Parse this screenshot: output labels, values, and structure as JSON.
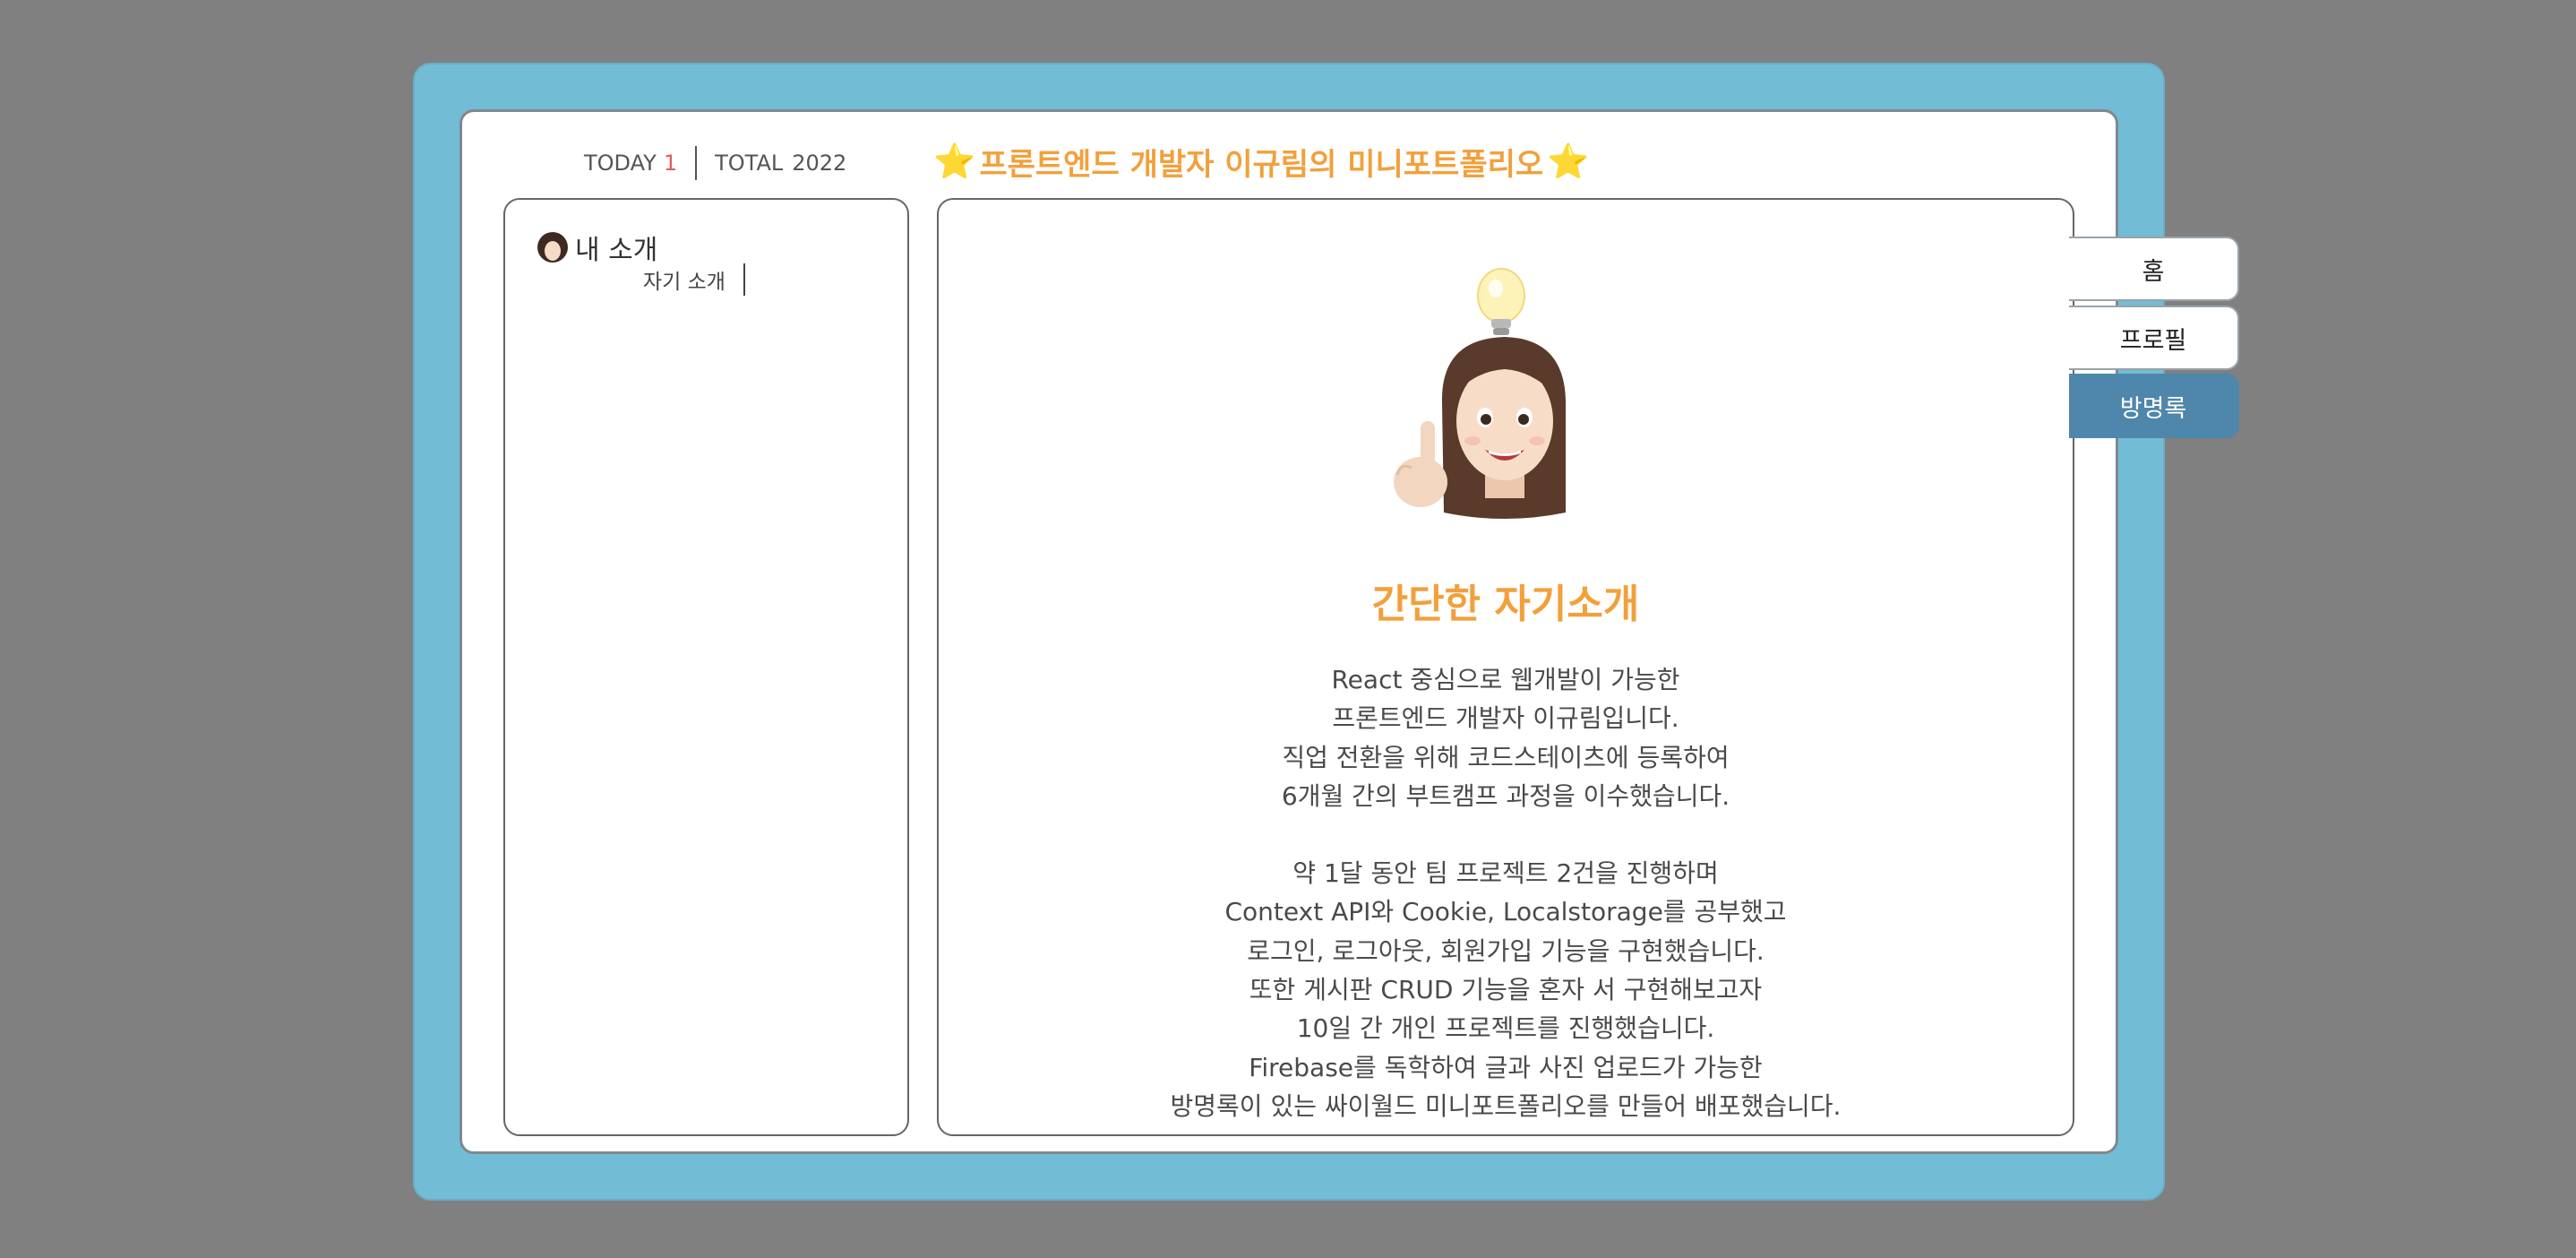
{
  "counter": {
    "today_label": "TODAY",
    "today_value": "1",
    "total_label": "TOTAL",
    "total_value": "2022"
  },
  "header": {
    "title": "프론트엔드 개발자 이규림의 미니포트폴리오",
    "star": "⭐"
  },
  "sidebar": {
    "menu_title": "내 소개",
    "menu_sub": "자기 소개"
  },
  "tabs": [
    {
      "label": "홈",
      "active": false
    },
    {
      "label": "프로필",
      "active": false
    },
    {
      "label": "방명록",
      "active": true
    }
  ],
  "main": {
    "heading": "간단한 자기소개",
    "paragraph1": [
      "React 중심으로 웹개발이 가능한",
      "프론트엔드 개발자 이규림입니다.",
      "직업 전환을 위해 코드스테이츠에 등록하여",
      "6개월 간의 부트캠프 과정을 이수했습니다."
    ],
    "paragraph2": [
      "약 1달 동안 팀 프로젝트 2건을 진행하며",
      "Context API와 Cookie, Localstorage를 공부했고",
      "로그인, 로그아웃, 회원가입 기능을 구현했습니다.",
      "또한 게시판 CRUD 기능을 혼자 서 구현해보고자",
      "10일 간 개인 프로젝트를 진행했습니다.",
      "Firebase를 독학하여 글과 사진 업로드가 가능한",
      "방명록이 있는 싸이월드 미니포트폴리오를 만들어 배포했습니다."
    ]
  },
  "colors": {
    "page_bg": "#808080",
    "frame": "#72bcd6",
    "accent": "#f2a03c",
    "active_tab": "#4f86ab"
  }
}
